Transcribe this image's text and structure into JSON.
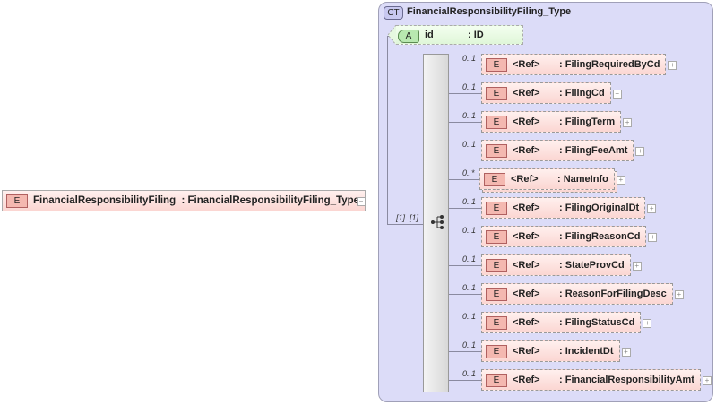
{
  "root": {
    "badge": "E",
    "name": "FinancialResponsibilityFiling",
    "type": ": FinancialResponsibilityFiling_Type"
  },
  "complex_type": {
    "badge": "CT",
    "name": "FinancialResponsibilityFiling_Type"
  },
  "attribute": {
    "badge": "A",
    "name": "id",
    "type": ": ID"
  },
  "sequence": {
    "multiplicity": "[1]..[1]"
  },
  "elements": [
    {
      "mult": "0..1",
      "badge": "E",
      "ref": "<Ref>",
      "type": ": FilingRequiredByCd"
    },
    {
      "mult": "0..1",
      "badge": "E",
      "ref": "<Ref>",
      "type": ": FilingCd"
    },
    {
      "mult": "0..1",
      "badge": "E",
      "ref": "<Ref>",
      "type": ": FilingTerm"
    },
    {
      "mult": "0..1",
      "badge": "E",
      "ref": "<Ref>",
      "type": ": FilingFeeAmt"
    },
    {
      "mult": "0..*",
      "badge": "E",
      "ref": "<Ref>",
      "type": ": NameInfo"
    },
    {
      "mult": "0..1",
      "badge": "E",
      "ref": "<Ref>",
      "type": ": FilingOriginalDt"
    },
    {
      "mult": "0..1",
      "badge": "E",
      "ref": "<Ref>",
      "type": ": FilingReasonCd"
    },
    {
      "mult": "0..1",
      "badge": "E",
      "ref": "<Ref>",
      "type": ": StateProvCd"
    },
    {
      "mult": "0..1",
      "badge": "E",
      "ref": "<Ref>",
      "type": ": ReasonForFilingDesc"
    },
    {
      "mult": "0..1",
      "badge": "E",
      "ref": "<Ref>",
      "type": ": FilingStatusCd"
    },
    {
      "mult": "0..1",
      "badge": "E",
      "ref": "<Ref>",
      "type": ": IncidentDt"
    },
    {
      "mult": "0..1",
      "badge": "E",
      "ref": "<Ref>",
      "type": ": FinancialResponsibilityAmt"
    }
  ]
}
